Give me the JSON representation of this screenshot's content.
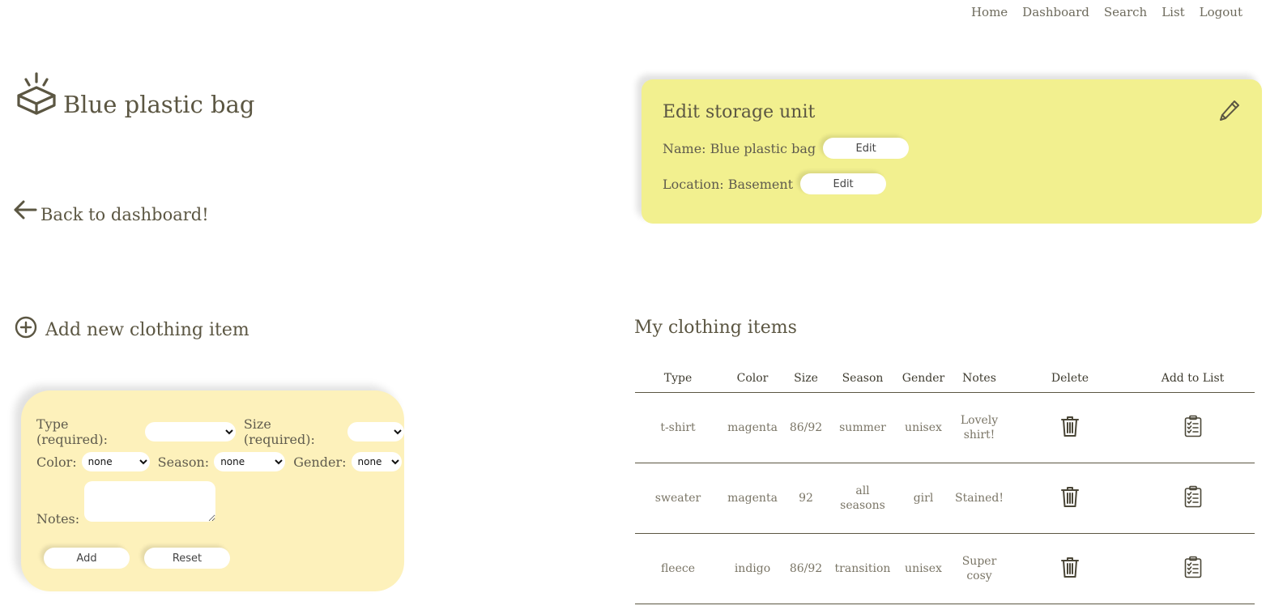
{
  "nav": [
    "Home",
    "Dashboard",
    "Search",
    "List",
    "Logout"
  ],
  "page_title": "Blue plastic bag",
  "back_link": "Back to dashboard!",
  "add_section": {
    "title": "Add new clothing item",
    "type_label": "Type (required):",
    "size_label": "Size (required):",
    "color_label": "Color:",
    "season_label": "Season:",
    "gender_label": "Gender:",
    "notes_label": "Notes:",
    "type_value": "",
    "size_value": "",
    "color_value": "none",
    "season_value": "none",
    "gender_value": "none",
    "add_button": "Add",
    "reset_button": "Reset"
  },
  "edit_card": {
    "title": "Edit storage unit",
    "name_label": "Name: Blue plastic bag",
    "location_label": "Location: Basement",
    "edit_button": "Edit"
  },
  "items_section": {
    "title": "My clothing items",
    "headers": [
      "Type",
      "Color",
      "Size",
      "Season",
      "Gender",
      "Notes",
      "Delete",
      "Add to List"
    ],
    "rows": [
      {
        "type": "t-shirt",
        "color": "magenta",
        "size": "86/92",
        "season": "summer",
        "gender": "unisex",
        "notes": "Lovely shirt!"
      },
      {
        "type": "sweater",
        "color": "magenta",
        "size": "92",
        "season": "all seasons",
        "gender": "girl",
        "notes": "Stained!"
      },
      {
        "type": "fleece",
        "color": "indigo",
        "size": "86/92",
        "season": "transition",
        "gender": "unisex",
        "notes": "Super cosy"
      }
    ]
  },
  "icons": {
    "logo": "open-box-icon",
    "back": "arrow-left-icon",
    "add": "plus-circle-icon",
    "edit": "pencil-icon",
    "delete": "trash-icon",
    "add_to_list": "clipboard-check-icon"
  },
  "colors": {
    "text": "#5b5642",
    "form_card_bg": "#fdf1bb",
    "edit_card_bg": "#f2f08f"
  }
}
